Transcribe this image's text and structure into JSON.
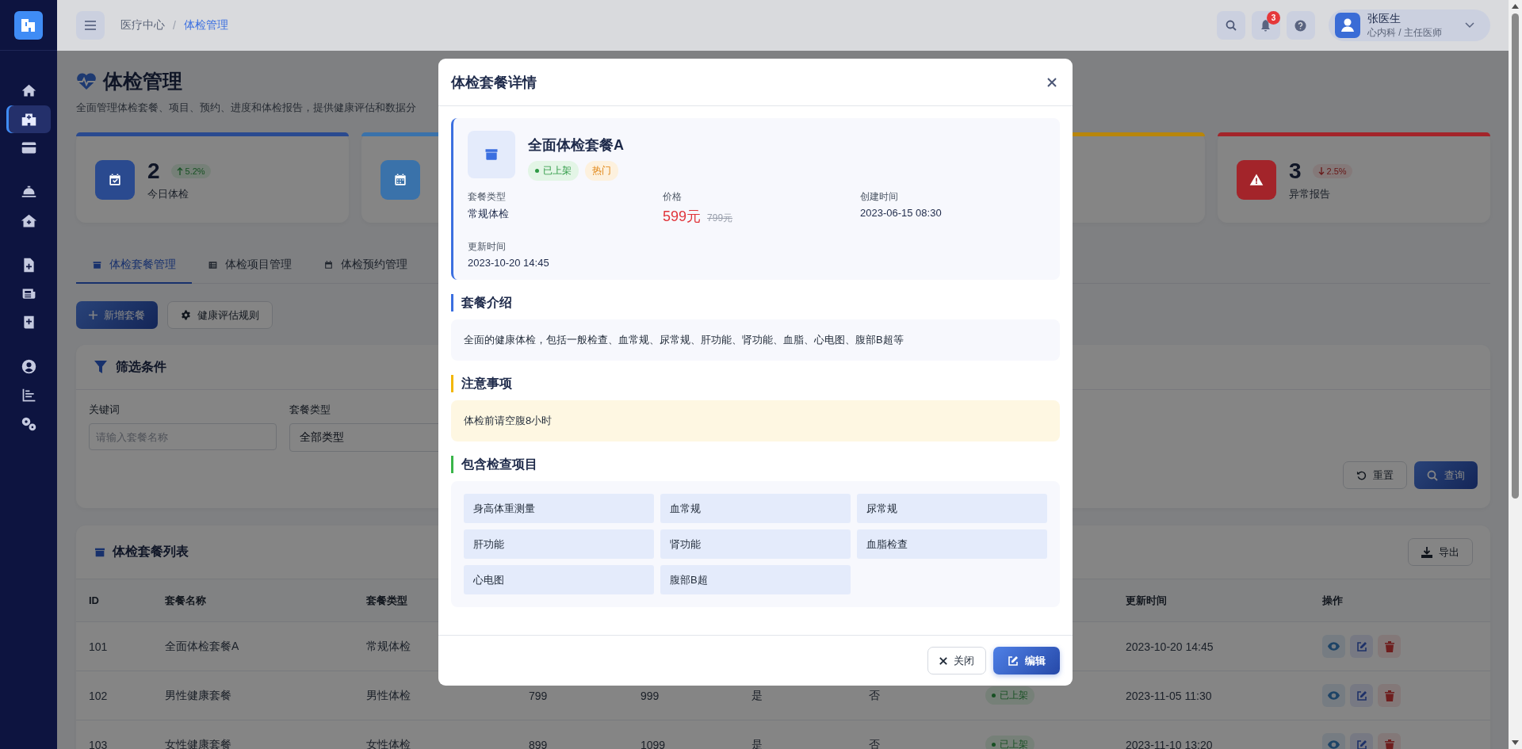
{
  "sidebar": {
    "groups": [
      {
        "items": [
          {
            "kind": "home",
            "selected": false
          },
          {
            "kind": "hospital",
            "selected": true
          },
          {
            "kind": "card",
            "selected": false
          }
        ]
      },
      {
        "items": [
          {
            "kind": "bell",
            "selected": false
          },
          {
            "kind": "house-medical",
            "selected": false
          }
        ]
      },
      {
        "items": [
          {
            "kind": "file-medical",
            "selected": false
          },
          {
            "kind": "newspaper",
            "selected": false
          },
          {
            "kind": "book-medical",
            "selected": false
          }
        ]
      },
      {
        "items": [
          {
            "kind": "user",
            "selected": false
          },
          {
            "kind": "chart",
            "selected": false
          },
          {
            "kind": "gears",
            "selected": false
          }
        ]
      }
    ]
  },
  "header": {
    "breadcrumb": [
      {
        "label": "医疗中心",
        "current": false
      },
      {
        "label": "体检管理",
        "current": true
      }
    ],
    "breadcrumb_separator": "/",
    "notification_count": "3",
    "user": {
      "name": "张医生",
      "role": "心内科 / 主任医师"
    }
  },
  "page": {
    "title": "体检管理",
    "subtitle": "全面管理体检套餐、项目、预约、进度和体检报告，提供健康评估和数据分"
  },
  "stats": [
    {
      "kind": "calendar-check",
      "color": "#2a4a8f",
      "value": "2",
      "change": {
        "kind": "up",
        "text": "5.2%"
      },
      "label": "今日体检"
    },
    {
      "kind": "calendar",
      "color": "#3a72aa"
    },
    {
      "color": "#b8860b"
    },
    {
      "kind": "warning",
      "color": "#a3242a",
      "value": "3",
      "change": {
        "kind": "down",
        "text": "2.5%"
      },
      "label": "异常报告"
    }
  ],
  "tabs": [
    {
      "label": "体检套餐管理",
      "kind": "box",
      "selected": true
    },
    {
      "label": "体检项目管理",
      "kind": "list",
      "selected": false
    },
    {
      "label": "体检预约管理",
      "kind": "calendar",
      "selected": false
    }
  ],
  "actions": [
    {
      "label": "新增套餐",
      "kind": "primary"
    },
    {
      "label": "健康评估规则",
      "kind": "secondary"
    }
  ],
  "filter": {
    "title": "筛选条件",
    "fields": [
      {
        "label": "关键词",
        "kind": "input",
        "placeholder": "请输入套餐名称"
      },
      {
        "label": "套餐类型",
        "kind": "select",
        "value": "全部类型"
      }
    ],
    "buttons": [
      {
        "label": "重置",
        "kind": "secondary"
      },
      {
        "label": "查询",
        "kind": "primary"
      }
    ]
  },
  "list": {
    "title": "体检套餐列表",
    "export": "导出",
    "columns": {
      "id": "ID",
      "name": "套餐名称",
      "type": "套餐类型",
      "updated": "更新时间",
      "actions": "操作"
    },
    "rows": [
      {
        "id": "101",
        "name": "全面体检套餐A",
        "type": "常规体检",
        "updated": "2023-10-20 14:45"
      },
      {
        "id": "102",
        "name": "男性健康套餐",
        "type": "男性体检",
        "column_4": "799",
        "column_5": "999",
        "column_6": "是",
        "column_7": "否",
        "status": "已上架",
        "updated": "2023-11-05 11:30"
      },
      {
        "id": "103",
        "name": "女性健康套餐",
        "type": "女性体检",
        "column_4": "899",
        "column_5": "1099",
        "column_6": "是",
        "column_7": "否",
        "status": "已上架",
        "updated": "2023-11-10 13:20"
      }
    ]
  },
  "modal": {
    "title": "体检套餐详情",
    "package": {
      "name": "全面体检套餐A",
      "badges": [
        {
          "label": "已上架",
          "kind": "status"
        },
        {
          "label": "热门",
          "kind": "hot"
        }
      ],
      "fields": [
        {
          "label": "套餐类型",
          "value": "常规体检",
          "kind": "text"
        },
        {
          "label": "价格",
          "value": "599元",
          "original": "799元",
          "kind": "price"
        },
        {
          "label": "创建时间",
          "value": "2023-06-15 08:30",
          "kind": "text"
        },
        {
          "label": "更新时间",
          "value": "2023-10-20 14:45",
          "kind": "text"
        }
      ]
    },
    "sections": [
      {
        "title": "套餐介绍",
        "kind": "intro",
        "text": "全面的健康体检，包括一般检查、血常规、尿常规、肝功能、肾功能、血脂、心电图、腹部B超等"
      },
      {
        "title": "注意事项",
        "kind": "notice",
        "text": "体检前请空腹8小时"
      },
      {
        "title": "包含检查项目",
        "kind": "items",
        "items": [
          "身高体重测量",
          "血常规",
          "尿常规",
          "肝功能",
          "肾功能",
          "血脂检查",
          "心电图",
          "腹部B超"
        ]
      }
    ],
    "buttons": [
      {
        "label": "关闭",
        "kind": "close"
      },
      {
        "label": "编辑",
        "kind": "edit"
      }
    ]
  }
}
